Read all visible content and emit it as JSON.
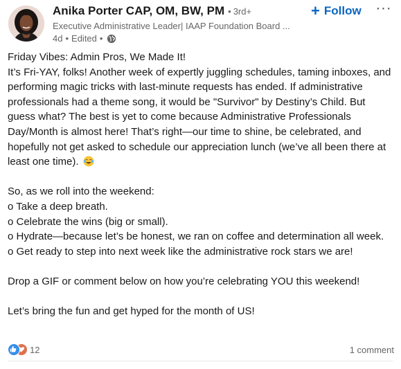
{
  "author": {
    "name": "Anika Porter CAP, OM, BW, PM",
    "degree_dot": "•",
    "degree": "3rd+",
    "headline": "Executive Administrative Leader| IAAP Foundation Board ...",
    "time": "4d",
    "edited": "Edited",
    "separator": "•",
    "visibility_icon": "globe-icon",
    "avatar_icon": "profile-photo"
  },
  "actions": {
    "follow_icon": "+",
    "follow_label": "Follow",
    "more_label": "···"
  },
  "post": {
    "lines": [
      "Friday Vibes: Admin Pros, We Made It!",
      "It’s Fri-YAY, folks! Another week of expertly juggling schedules, taming inboxes, and performing magic tricks with last-minute requests has ended. If administrative professionals had a theme song, it would be \"Survivor\" by Destiny’s Child. But guess what? The best is yet to come because Administrative Professionals Day/Month is almost here! That’s right—our time to shine, be celebrated, and hopefully not get asked to schedule our appreciation lunch (we’ve all been there at least one time).",
      "So, as we roll into the weekend:",
      "o  Take a deep breath.",
      "o  Celebrate the wins (big or small).",
      "o  Hydrate—because let’s be honest, we ran on coffee and determination all week.",
      "o  Get ready to step into next week like the administrative rock stars we are!",
      "Drop a GIF or comment below on how you’re celebrating YOU this weekend!",
      "Let’s bring the fun and get hyped for the month of US!"
    ],
    "emoji_icon": "laughing-tears-emoji"
  },
  "social": {
    "reaction_icons": [
      "like-icon",
      "love-icon"
    ],
    "reaction_count": "12",
    "comments": "1 comment"
  },
  "colors": {
    "link_blue": "#0a66c2",
    "like_blue": "#378fe9",
    "love_orange": "#df704d",
    "muted_text": "#666666"
  }
}
